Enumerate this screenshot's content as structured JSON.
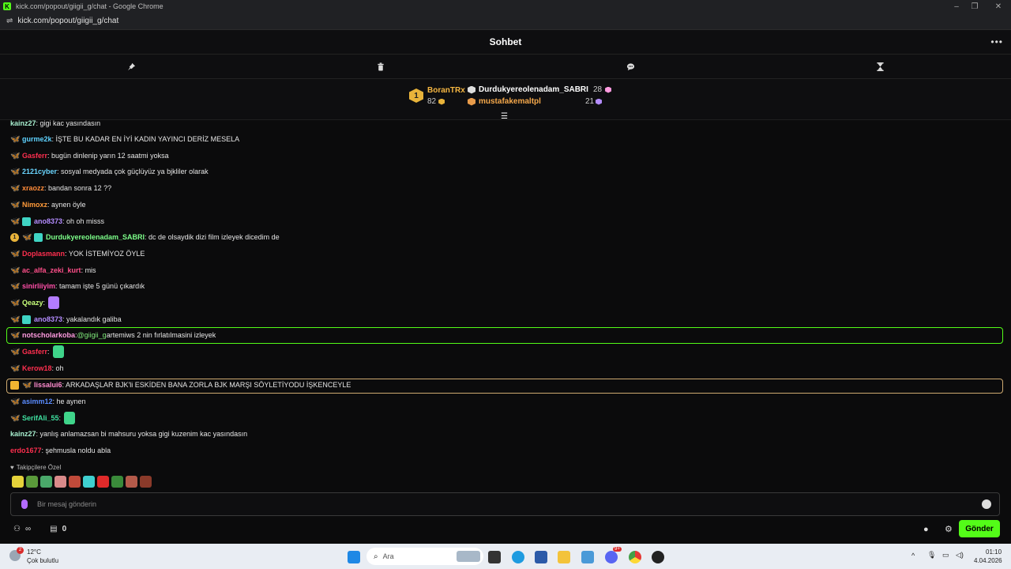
{
  "window": {
    "title": "kick.com/popout/giigii_g/chat - Google Chrome",
    "url": "kick.com/popout/giigii_g/chat"
  },
  "header": {
    "title": "Sohbet",
    "more": "•••"
  },
  "toolbar": {
    "icons": [
      "pin-icon",
      "trash-icon",
      "chat-bubble-icon",
      "hourglass-icon"
    ]
  },
  "leaderboard": {
    "first": {
      "rank": "1",
      "name": "BoranTRx",
      "count": "82",
      "name_color": "#f5b642"
    },
    "second": {
      "name": "Durdukyereolenadam_SABRI",
      "count": "28"
    },
    "third": {
      "name": "mustafakemaltpl",
      "count": "21",
      "name_color": "#f5a84b"
    }
  },
  "messages": [
    {
      "user": "kainz27",
      "color": "#a8f0d0",
      "text": ": gigi kac yasındasın"
    },
    {
      "user": "gurme2k",
      "color": "#5fd3ff",
      "text": ": İŞTE BU KADAR EN İYİ KADIN YAYINCI DERİZ MESELA"
    },
    {
      "user": "Gasferr",
      "color": "#ff2f4f",
      "text": ": bugün dinlenip yarın 12 saatmi yoksa"
    },
    {
      "user": "2121cyber",
      "color": "#6ad6ff",
      "text": ": sosyal medyada çok güçlüyüz ya bjkliler olarak"
    },
    {
      "user": "xraozz",
      "color": "#ff8c3a",
      "text": ": bandan sonra 12 ??"
    },
    {
      "user": "Nimoxz",
      "color": "#ff9b3a",
      "text": ": aynen öyle"
    },
    {
      "user": "ano8373",
      "color": "#b48cff",
      "text": ": oh oh misss"
    },
    {
      "user": "Durdukyereolenadam_SABRI",
      "color": "#7dff8a",
      "text": ": dc de olsaydik dizi film izleyek dicedim de"
    },
    {
      "user": "Doplasmann",
      "color": "#ff2f4f",
      "text": ": YOK İSTEMİYOZ ÖYLE"
    },
    {
      "user": "ac_alfa_zeki_kurt",
      "color": "#ff4f8a",
      "text": ": mis"
    },
    {
      "user": "sinirliiyim",
      "color": "#ff4fa8",
      "text": ": tamam işte 5 günü çıkardık"
    },
    {
      "user": "Qeazy",
      "color": "#c8ff7a",
      "text": ":"
    },
    {
      "user": "ano8373",
      "color": "#b48cff",
      "text": ": yakalandık galiba"
    },
    {
      "user": "notscholarkoba",
      "color": "#ff9be0",
      "text": ": ",
      "mention": "@giigii_g",
      "rest": " artemiws 2 nin fırlatılmasini izleyek"
    },
    {
      "user": "Gasferr",
      "color": "#ff2f4f",
      "text": ":"
    },
    {
      "user": "Kerow18",
      "color": "#ff2f4f",
      "text": ": oh"
    },
    {
      "user": "lissalui6",
      "color": "#ff8cd0",
      "text": ": ARKADAŞLAR BJK'li ESKİDEN BANA ZORLA BJK MARŞI SÖYLETİYODU İŞKENCEYLE"
    },
    {
      "user": "asimm12",
      "color": "#5a8cff",
      "text": ": he aynen"
    },
    {
      "user": "SerifAli_55",
      "color": "#3fe0a0",
      "text": ":"
    },
    {
      "user": "kainz27",
      "color": "#a8f0d0",
      "text": ": yanlış anlamazsan bi mahsuru yoksa gigi kuzenim kac yasındasın"
    },
    {
      "user": "erdo1677",
      "color": "#ff2f4f",
      "text": ": şehmusla noldu abla"
    }
  ],
  "followers_only": {
    "label": "Takipçilere Özel"
  },
  "input": {
    "placeholder": "Bir mesaj gönderin"
  },
  "bottom": {
    "points_symbol": "∞",
    "count": "0",
    "send_label": "Gönder"
  },
  "taskbar": {
    "weather_temp": "12°C",
    "weather_desc": "Çok bulutlu",
    "weather_badge": "2",
    "search": "Ara",
    "time": "01:10",
    "date": "4.04.2026",
    "discord_badge": "9+"
  },
  "colors": {
    "accent": "#53fc18",
    "background": "#0b0b0c"
  }
}
